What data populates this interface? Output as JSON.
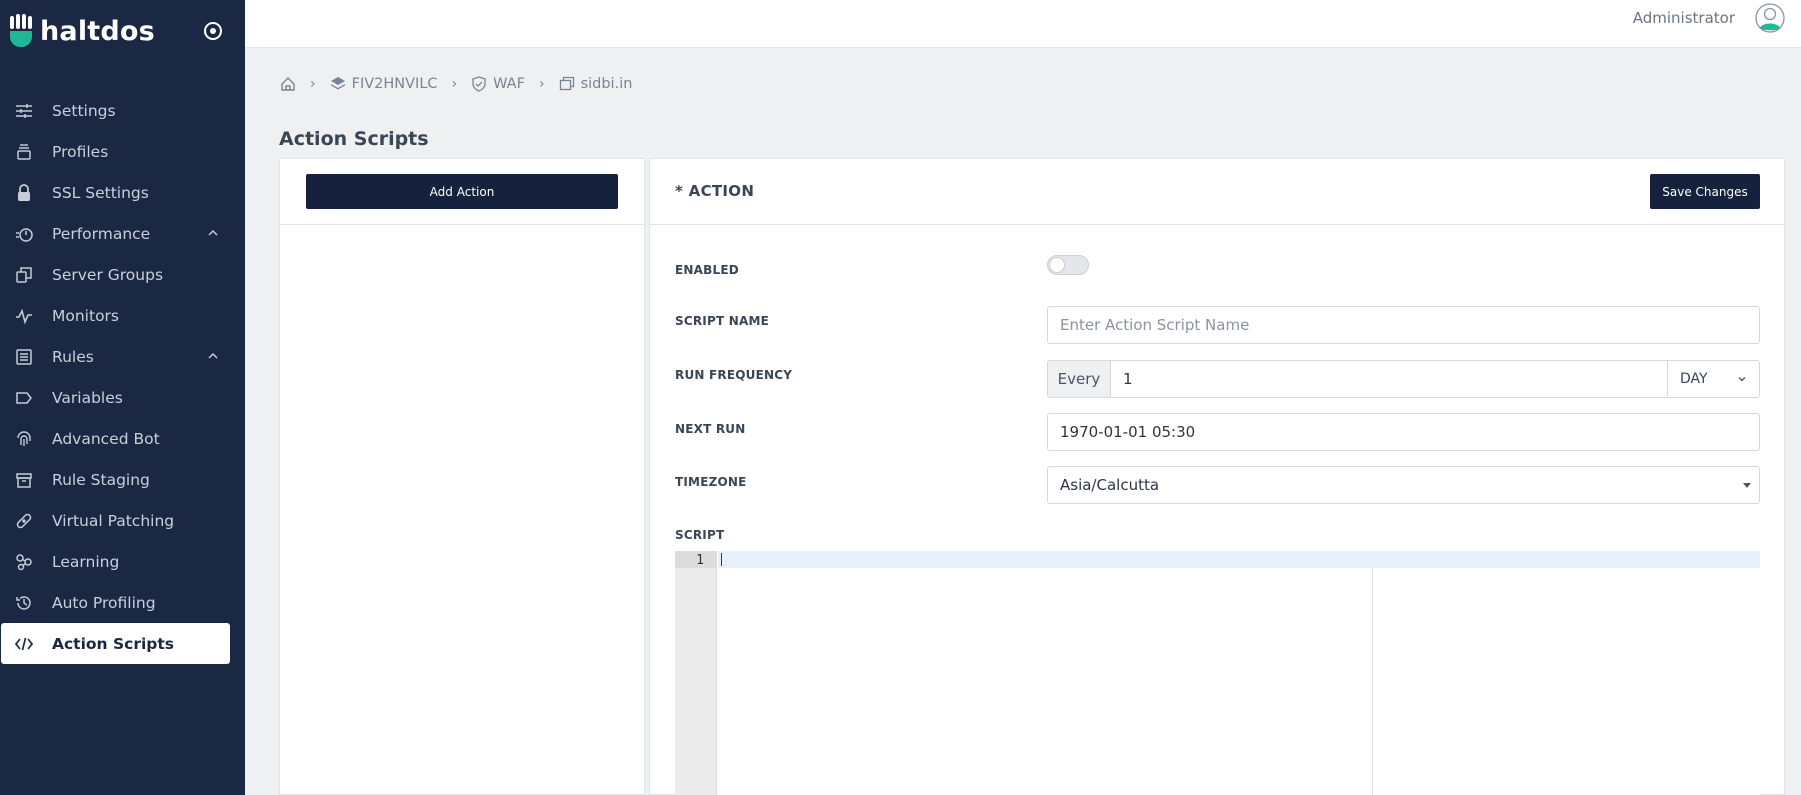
{
  "app": {
    "brand": "haltdos"
  },
  "colors": {
    "sidebar_bg": "#1b2844",
    "primary_button": "#15213d",
    "brand_accent": "#1fb895"
  },
  "sidebar": {
    "items": [
      {
        "label": "Settings",
        "icon": "sliders-icon"
      },
      {
        "label": "Profiles",
        "icon": "layers-icon"
      },
      {
        "label": "SSL Settings",
        "icon": "lock-icon"
      },
      {
        "label": "Performance",
        "icon": "stopwatch-icon",
        "expandable": true
      },
      {
        "label": "Server Groups",
        "icon": "copy-icon"
      },
      {
        "label": "Monitors",
        "icon": "pulse-icon"
      },
      {
        "label": "Rules",
        "icon": "list-icon",
        "expandable": true
      },
      {
        "label": "Variables",
        "icon": "tag-icon"
      },
      {
        "label": "Advanced Bot",
        "icon": "fingerprint-icon"
      },
      {
        "label": "Rule Staging",
        "icon": "archive-icon"
      },
      {
        "label": "Virtual Patching",
        "icon": "bandage-icon"
      },
      {
        "label": "Learning",
        "icon": "molecule-icon"
      },
      {
        "label": "Auto Profiling",
        "icon": "history-icon"
      },
      {
        "label": "Action Scripts",
        "icon": "code-icon",
        "active": true
      }
    ]
  },
  "header": {
    "user": "Administrator"
  },
  "breadcrumb": [
    {
      "label": "",
      "icon": "home-icon"
    },
    {
      "label": "FIV2HNVILC",
      "icon": "stack-icon"
    },
    {
      "label": "WAF",
      "icon": "shield-check-icon"
    },
    {
      "label": "sidbi.in",
      "icon": "window-icon"
    }
  ],
  "page": {
    "title": "Action Scripts"
  },
  "left_panel": {
    "add_button": "Add Action"
  },
  "form": {
    "title": "* ACTION",
    "save_button": "Save Changes",
    "enabled_label": "ENABLED",
    "enabled": false,
    "script_name_label": "SCRIPT NAME",
    "script_name_placeholder": "Enter Action Script Name",
    "script_name_value": "",
    "run_frequency_label": "RUN FREQUENCY",
    "run_frequency_prefix": "Every",
    "run_frequency_value": "1",
    "run_frequency_unit": "DAY",
    "next_run_label": "NEXT RUN",
    "next_run_value": "1970-01-01 05:30",
    "timezone_label": "TIMEZONE",
    "timezone_value": "Asia/Calcutta",
    "script_label": "SCRIPT",
    "script_line_number": "1"
  }
}
